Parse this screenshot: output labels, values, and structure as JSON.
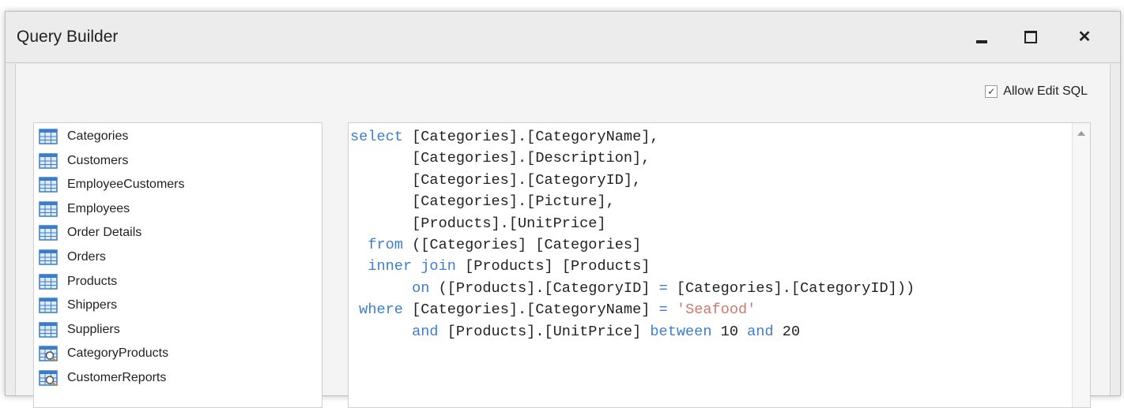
{
  "window": {
    "title": "Query Builder"
  },
  "options": {
    "allow_edit_sql_label": "Allow Edit SQL",
    "allow_edit_sql_checked": true,
    "check_glyph": "✓"
  },
  "tables": [
    {
      "label": "Categories",
      "icon": "table-icon"
    },
    {
      "label": "Customers",
      "icon": "table-icon"
    },
    {
      "label": "EmployeeCustomers",
      "icon": "table-icon"
    },
    {
      "label": "Employees",
      "icon": "table-icon"
    },
    {
      "label": "Order Details",
      "icon": "table-icon"
    },
    {
      "label": "Orders",
      "icon": "table-icon"
    },
    {
      "label": "Products",
      "icon": "table-icon"
    },
    {
      "label": "Shippers",
      "icon": "table-icon"
    },
    {
      "label": "Suppliers",
      "icon": "table-icon"
    },
    {
      "label": "CategoryProducts",
      "icon": "view-icon"
    },
    {
      "label": "CustomerReports",
      "icon": "view-icon"
    }
  ],
  "sql": {
    "lines": [
      [
        {
          "t": "select",
          "c": "kw"
        },
        {
          "t": " [Categories].[CategoryName],"
        }
      ],
      [
        {
          "t": "       [Categories].[Description],"
        }
      ],
      [
        {
          "t": "       [Categories].[CategoryID],"
        }
      ],
      [
        {
          "t": "       [Categories].[Picture],"
        }
      ],
      [
        {
          "t": "       [Products].[UnitPrice]"
        }
      ],
      [
        {
          "t": "  "
        },
        {
          "t": "from",
          "c": "kw"
        },
        {
          "t": " ([Categories] [Categories]"
        }
      ],
      [
        {
          "t": "  "
        },
        {
          "t": "inner join",
          "c": "kw"
        },
        {
          "t": " [Products] [Products]"
        }
      ],
      [
        {
          "t": "       "
        },
        {
          "t": "on",
          "c": "kw"
        },
        {
          "t": " ([Products].[CategoryID] "
        },
        {
          "t": "=",
          "c": "kw"
        },
        {
          "t": " [Categories].[CategoryID]))"
        }
      ],
      [
        {
          "t": " "
        },
        {
          "t": "where",
          "c": "kw"
        },
        {
          "t": " [Categories].[CategoryName] "
        },
        {
          "t": "=",
          "c": "kw"
        },
        {
          "t": " "
        },
        {
          "t": "'Seafood'",
          "c": "str"
        }
      ],
      [
        {
          "t": "       "
        },
        {
          "t": "and",
          "c": "kw"
        },
        {
          "t": " [Products].[UnitPrice] "
        },
        {
          "t": "between",
          "c": "kw"
        },
        {
          "t": " 10 ",
          "c": "num"
        },
        {
          "t": "and",
          "c": "kw"
        },
        {
          "t": " 20",
          "c": "num"
        }
      ]
    ]
  },
  "colors": {
    "keyword": "#3c7fd0",
    "string": "#d0786a",
    "table_icon": "#3b7ccc"
  }
}
